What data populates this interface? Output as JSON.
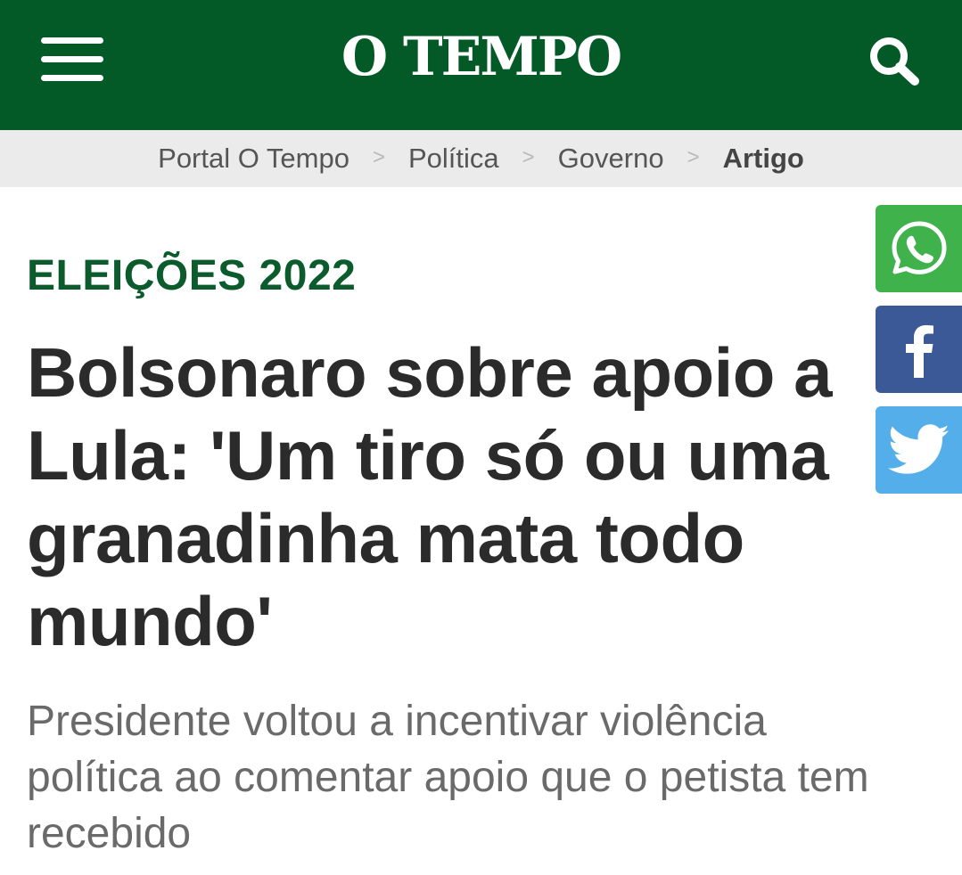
{
  "header": {
    "logo": "O TEMPO",
    "menu_icon": "hamburger-menu-icon",
    "search_icon": "search-icon",
    "background_color": "#035a27"
  },
  "breadcrumb": {
    "items": [
      "Portal O Tempo",
      "Política",
      "Governo"
    ],
    "separator": ">",
    "current": "Artigo"
  },
  "article": {
    "kicker": "ELEIÇÕES 2022",
    "kicker_color": "#0c5b2d",
    "title": "Bolsonaro sobre apoio a Lula: 'Um tiro só ou uma granadinha mata todo mundo'",
    "subtitle": "Presidente voltou a incentivar violência política ao comentar apoio que o petista tem recebido"
  },
  "share": {
    "whatsapp": {
      "icon": "whatsapp-icon",
      "color": "#3fb24c"
    },
    "facebook": {
      "icon": "facebook-icon",
      "color": "#3b5997"
    },
    "twitter": {
      "icon": "twitter-icon",
      "color": "#54aee9"
    }
  }
}
